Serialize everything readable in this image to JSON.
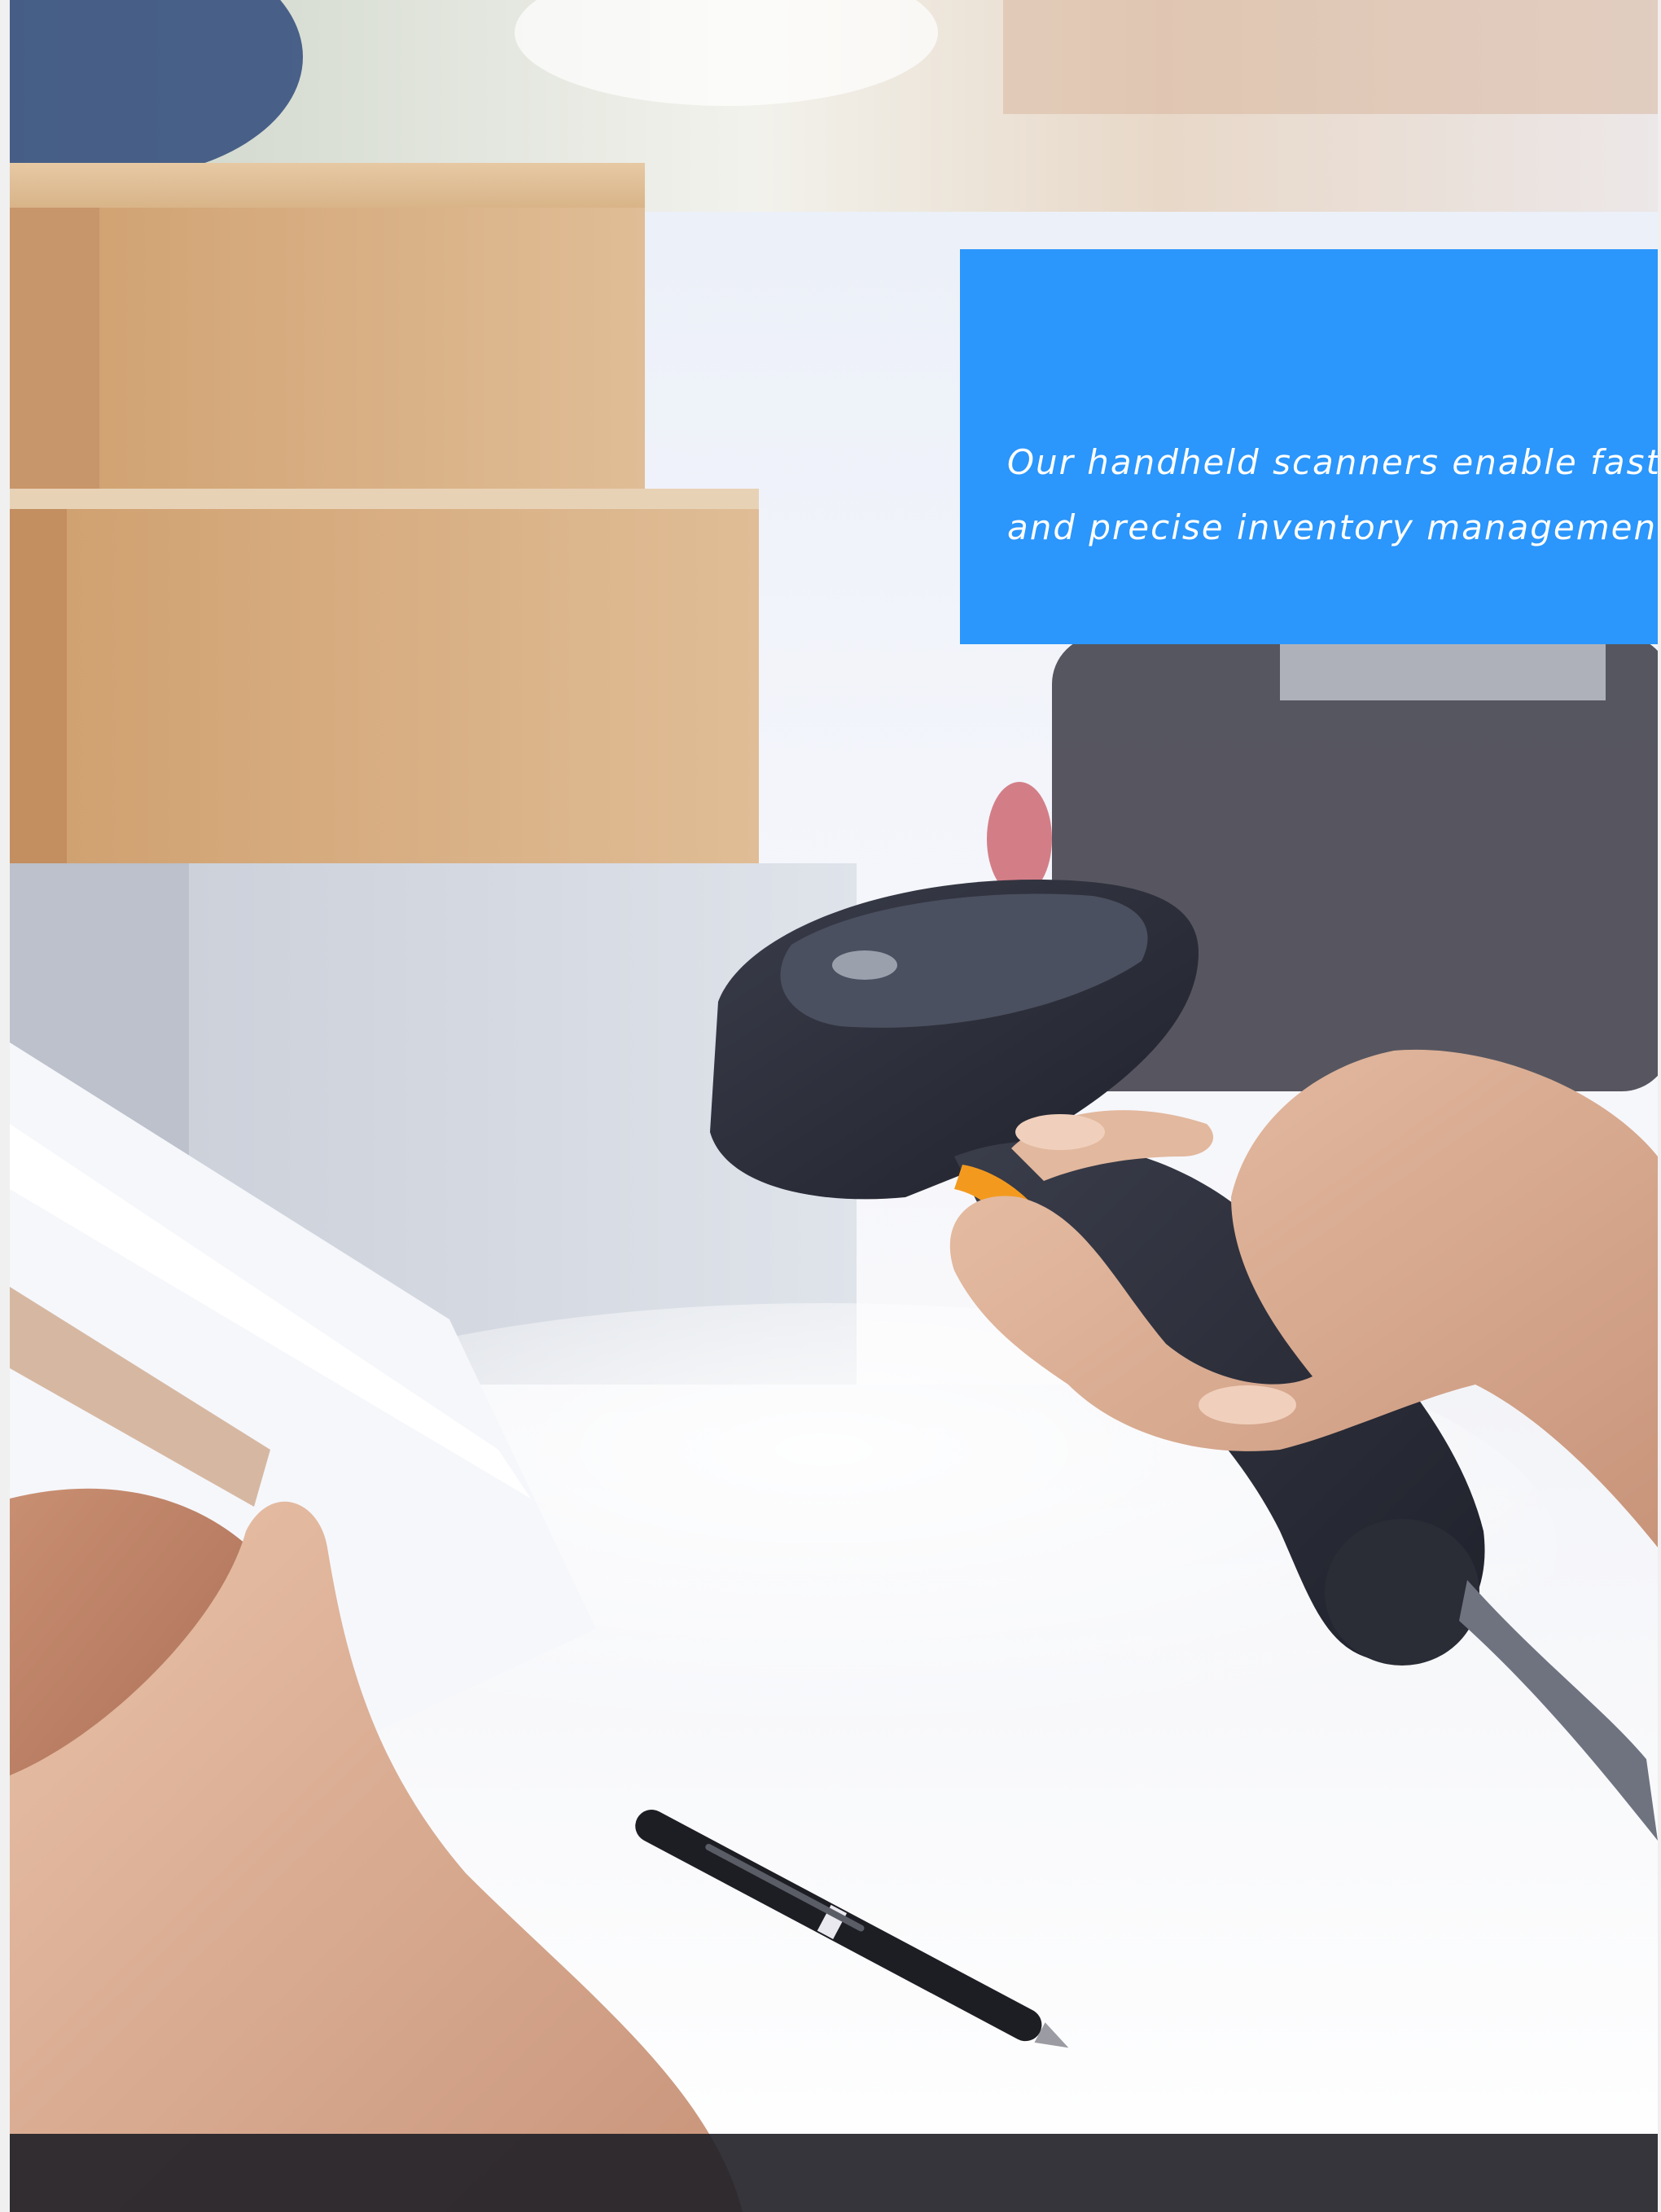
{
  "hero_image": {
    "subject": "hand-holding-barcode-scanner",
    "elements": [
      "cardboard-boxes",
      "barcode-scanner",
      "clipboard",
      "pen",
      "hands"
    ]
  },
  "callout": {
    "background_color": "#2b96fb",
    "text_color": "#ffffff",
    "line_1": "Our handheld scanners enable fast tran",
    "line_2": "and precise inventory management."
  }
}
